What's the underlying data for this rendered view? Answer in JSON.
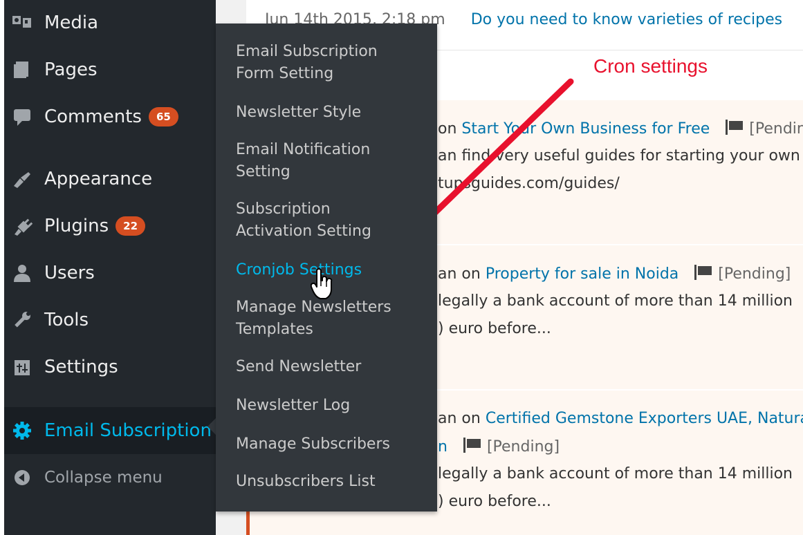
{
  "sidebar": {
    "items": [
      {
        "label": "Media",
        "icon": "media-icon"
      },
      {
        "label": "Pages",
        "icon": "pages-icon"
      },
      {
        "label": "Comments",
        "icon": "comments-icon",
        "badge": "65"
      },
      {
        "label": "Appearance",
        "icon": "appearance-icon"
      },
      {
        "label": "Plugins",
        "icon": "plugins-icon",
        "badge": "22"
      },
      {
        "label": "Users",
        "icon": "users-icon"
      },
      {
        "label": "Tools",
        "icon": "tools-icon"
      },
      {
        "label": "Settings",
        "icon": "settings-icon"
      },
      {
        "label": "Email Subscription",
        "icon": "gear-icon",
        "active": true
      },
      {
        "label": "Collapse menu",
        "icon": "collapse-icon"
      }
    ]
  },
  "submenu": {
    "items": [
      {
        "label": "Email Subscription\nForm Setting"
      },
      {
        "label": "Newsletter Style"
      },
      {
        "label": "Email Notification\nSetting"
      },
      {
        "label": "Subscription\nActivation Setting"
      },
      {
        "label": "Cronjob Settings",
        "current": true
      },
      {
        "label": "Manage Newsletters\nTemplates"
      },
      {
        "label": "Send Newsletter"
      },
      {
        "label": "Newsletter Log"
      },
      {
        "label": "Manage Subscribers"
      },
      {
        "label": "Unsubscribers List"
      }
    ]
  },
  "content": {
    "top_date": "Jun 14th 2015, 2:18 pm",
    "top_link": "Do you need to know varieties of recipes",
    "comments": [
      {
        "line1_prefix": "on",
        "post_link": "Start Your Own Business for Free",
        "status": "[Pending]",
        "line2": "an find very useful guides for starting your own",
        "line3": "tupsguides.com/guides/"
      },
      {
        "line1_prefix": "an on",
        "post_link": "Property for sale in Noida",
        "status": "[Pending]",
        "line2": "legally a bank account of more than 14 million",
        "line3": ") euro before..."
      },
      {
        "line1_prefix": "an on",
        "post_link": "Certified Gemstone Exporters UAE, Natural",
        "post_link_cont": "n",
        "status": "[Pending]",
        "line2": "legally a bank account of more than 14 million",
        "line3": ") euro before..."
      }
    ]
  },
  "annotation": {
    "label": "Cron settings",
    "color": "#e8112d"
  },
  "colors": {
    "sidebar_bg": "#23282d",
    "flyout_bg": "#32373c",
    "accent": "#00b9eb",
    "badge": "#d54e21",
    "link": "#0073aa"
  }
}
